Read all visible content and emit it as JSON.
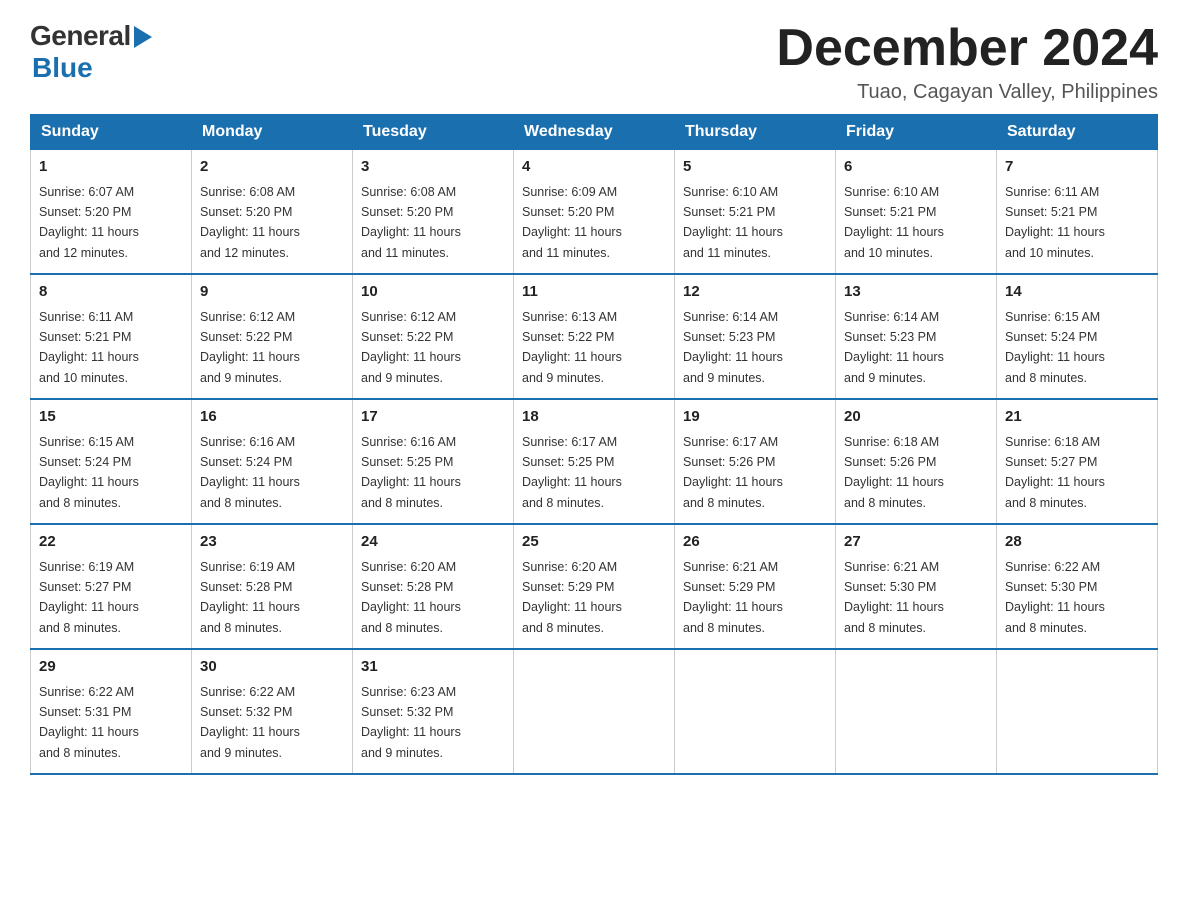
{
  "header": {
    "logo": {
      "general": "General",
      "blue": "Blue"
    },
    "title": "December 2024",
    "subtitle": "Tuao, Cagayan Valley, Philippines"
  },
  "days_of_week": [
    "Sunday",
    "Monday",
    "Tuesday",
    "Wednesday",
    "Thursday",
    "Friday",
    "Saturday"
  ],
  "weeks": [
    [
      {
        "day": "1",
        "sunrise": "6:07 AM",
        "sunset": "5:20 PM",
        "daylight": "11 hours and 12 minutes."
      },
      {
        "day": "2",
        "sunrise": "6:08 AM",
        "sunset": "5:20 PM",
        "daylight": "11 hours and 12 minutes."
      },
      {
        "day": "3",
        "sunrise": "6:08 AM",
        "sunset": "5:20 PM",
        "daylight": "11 hours and 11 minutes."
      },
      {
        "day": "4",
        "sunrise": "6:09 AM",
        "sunset": "5:20 PM",
        "daylight": "11 hours and 11 minutes."
      },
      {
        "day": "5",
        "sunrise": "6:10 AM",
        "sunset": "5:21 PM",
        "daylight": "11 hours and 11 minutes."
      },
      {
        "day": "6",
        "sunrise": "6:10 AM",
        "sunset": "5:21 PM",
        "daylight": "11 hours and 10 minutes."
      },
      {
        "day": "7",
        "sunrise": "6:11 AM",
        "sunset": "5:21 PM",
        "daylight": "11 hours and 10 minutes."
      }
    ],
    [
      {
        "day": "8",
        "sunrise": "6:11 AM",
        "sunset": "5:21 PM",
        "daylight": "11 hours and 10 minutes."
      },
      {
        "day": "9",
        "sunrise": "6:12 AM",
        "sunset": "5:22 PM",
        "daylight": "11 hours and 9 minutes."
      },
      {
        "day": "10",
        "sunrise": "6:12 AM",
        "sunset": "5:22 PM",
        "daylight": "11 hours and 9 minutes."
      },
      {
        "day": "11",
        "sunrise": "6:13 AM",
        "sunset": "5:22 PM",
        "daylight": "11 hours and 9 minutes."
      },
      {
        "day": "12",
        "sunrise": "6:14 AM",
        "sunset": "5:23 PM",
        "daylight": "11 hours and 9 minutes."
      },
      {
        "day": "13",
        "sunrise": "6:14 AM",
        "sunset": "5:23 PM",
        "daylight": "11 hours and 9 minutes."
      },
      {
        "day": "14",
        "sunrise": "6:15 AM",
        "sunset": "5:24 PM",
        "daylight": "11 hours and 8 minutes."
      }
    ],
    [
      {
        "day": "15",
        "sunrise": "6:15 AM",
        "sunset": "5:24 PM",
        "daylight": "11 hours and 8 minutes."
      },
      {
        "day": "16",
        "sunrise": "6:16 AM",
        "sunset": "5:24 PM",
        "daylight": "11 hours and 8 minutes."
      },
      {
        "day": "17",
        "sunrise": "6:16 AM",
        "sunset": "5:25 PM",
        "daylight": "11 hours and 8 minutes."
      },
      {
        "day": "18",
        "sunrise": "6:17 AM",
        "sunset": "5:25 PM",
        "daylight": "11 hours and 8 minutes."
      },
      {
        "day": "19",
        "sunrise": "6:17 AM",
        "sunset": "5:26 PM",
        "daylight": "11 hours and 8 minutes."
      },
      {
        "day": "20",
        "sunrise": "6:18 AM",
        "sunset": "5:26 PM",
        "daylight": "11 hours and 8 minutes."
      },
      {
        "day": "21",
        "sunrise": "6:18 AM",
        "sunset": "5:27 PM",
        "daylight": "11 hours and 8 minutes."
      }
    ],
    [
      {
        "day": "22",
        "sunrise": "6:19 AM",
        "sunset": "5:27 PM",
        "daylight": "11 hours and 8 minutes."
      },
      {
        "day": "23",
        "sunrise": "6:19 AM",
        "sunset": "5:28 PM",
        "daylight": "11 hours and 8 minutes."
      },
      {
        "day": "24",
        "sunrise": "6:20 AM",
        "sunset": "5:28 PM",
        "daylight": "11 hours and 8 minutes."
      },
      {
        "day": "25",
        "sunrise": "6:20 AM",
        "sunset": "5:29 PM",
        "daylight": "11 hours and 8 minutes."
      },
      {
        "day": "26",
        "sunrise": "6:21 AM",
        "sunset": "5:29 PM",
        "daylight": "11 hours and 8 minutes."
      },
      {
        "day": "27",
        "sunrise": "6:21 AM",
        "sunset": "5:30 PM",
        "daylight": "11 hours and 8 minutes."
      },
      {
        "day": "28",
        "sunrise": "6:22 AM",
        "sunset": "5:30 PM",
        "daylight": "11 hours and 8 minutes."
      }
    ],
    [
      {
        "day": "29",
        "sunrise": "6:22 AM",
        "sunset": "5:31 PM",
        "daylight": "11 hours and 8 minutes."
      },
      {
        "day": "30",
        "sunrise": "6:22 AM",
        "sunset": "5:32 PM",
        "daylight": "11 hours and 9 minutes."
      },
      {
        "day": "31",
        "sunrise": "6:23 AM",
        "sunset": "5:32 PM",
        "daylight": "11 hours and 9 minutes."
      },
      null,
      null,
      null,
      null
    ]
  ],
  "labels": {
    "sunrise": "Sunrise:",
    "sunset": "Sunset:",
    "daylight": "Daylight:"
  }
}
